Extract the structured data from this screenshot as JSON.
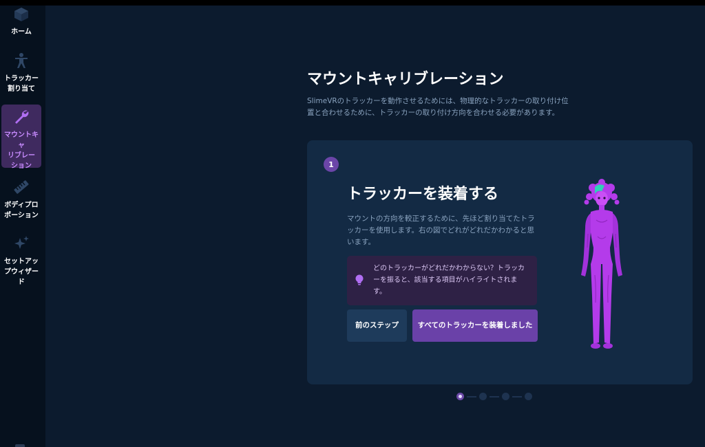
{
  "sidebar": {
    "items": [
      {
        "label": "ホーム",
        "icon": "cube-icon"
      },
      {
        "label": "トラッカー\n割り当て",
        "icon": "person-icon"
      },
      {
        "label": "マウントキャ\nリブレー\nション",
        "icon": "wrench-icon",
        "active": true
      },
      {
        "label": "ボディプロ\nポーション",
        "icon": "ruler-icon"
      },
      {
        "label": "セットアッ\nプウィザー\nド",
        "icon": "sparkle-icon"
      }
    ]
  },
  "main": {
    "title": "マウントキャリブレーション",
    "description": "SlimeVRのトラッカーを動作させるためには、物理的なトラッカーの取り付け位置と合わせるために、トラッカーの取り付け方向を合わせる必要があります。"
  },
  "step": {
    "number": "1",
    "title": "トラッカーを装着する",
    "description": "マウントの方向を較正するために、先ほど割り当てたトラッカーを使用します。右の図でどれがどれだかわかると思います。",
    "hint": "どのトラッカーがどれだかわからない？トラッカーを振ると、該当する項目がハイライトされます。",
    "prev_label": "前のステップ",
    "done_label": "すべてのトラッカーを装着しました"
  },
  "pagination": {
    "current": 1,
    "total": 4
  },
  "colors": {
    "background": "#0c1b2e",
    "sidebar": "#06111e",
    "card": "#132a44",
    "accent": "#6a41a8",
    "figure": "#b43bea"
  }
}
